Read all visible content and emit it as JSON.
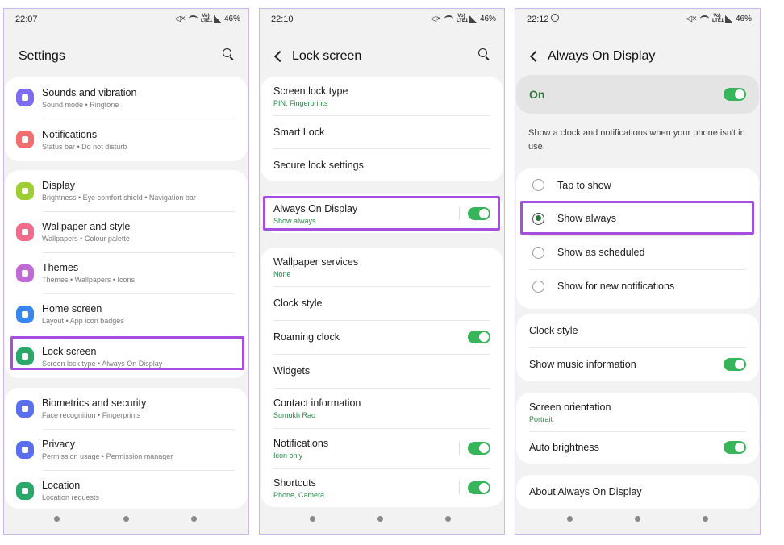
{
  "screens": [
    {
      "time": "22:07",
      "battery": "46%",
      "title": "Settings",
      "groups": [
        [
          {
            "icon": "sound-icon",
            "color": "#7b6cf0",
            "title": "Sounds and vibration",
            "sub": "Sound mode  •  Ringtone"
          },
          {
            "icon": "notification-icon",
            "color": "#f26d6d",
            "title": "Notifications",
            "sub": "Status bar  •  Do not disturb"
          }
        ],
        [
          {
            "icon": "display-icon",
            "color": "#9ccf2f",
            "title": "Display",
            "sub": "Brightness  •  Eye comfort shield  •  Navigation bar"
          },
          {
            "icon": "wallpaper-icon",
            "color": "#f06a8a",
            "title": "Wallpaper and style",
            "sub": "Wallpapers  •  Colour palette"
          },
          {
            "icon": "themes-icon",
            "color": "#c06ad8",
            "title": "Themes",
            "sub": "Themes  •  Wallpapers  •  Icons"
          },
          {
            "icon": "home-icon",
            "color": "#3a86f0",
            "title": "Home screen",
            "sub": "Layout  •  App icon badges"
          },
          {
            "icon": "lock-icon",
            "color": "#2aa86a",
            "title": "Lock screen",
            "sub": "Screen lock type  •  Always On Display"
          }
        ],
        [
          {
            "icon": "shield-icon",
            "color": "#5a6ef0",
            "title": "Biometrics and security",
            "sub": "Face recognition  •  Fingerprints"
          },
          {
            "icon": "privacy-icon",
            "color": "#5a6ef0",
            "title": "Privacy",
            "sub": "Permission usage  •  Permission manager"
          },
          {
            "icon": "location-icon",
            "color": "#2aa86a",
            "title": "Location",
            "sub": "Location requests"
          }
        ]
      ]
    },
    {
      "time": "22:10",
      "battery": "46%",
      "title": "Lock screen",
      "groups": [
        [
          {
            "title": "Screen lock type",
            "sub": "PIN, Fingerprints"
          },
          {
            "title": "Smart Lock",
            "sub": ""
          },
          {
            "title": "Secure lock settings",
            "sub": ""
          }
        ],
        [
          {
            "title": "Always On Display",
            "sub": "Show always",
            "toggle": true
          }
        ],
        [
          {
            "title": "Wallpaper services",
            "sub": "None"
          },
          {
            "title": "Clock style",
            "sub": ""
          },
          {
            "title": "Roaming clock",
            "sub": "",
            "toggle": true
          },
          {
            "title": "Widgets",
            "sub": ""
          },
          {
            "title": "Contact information",
            "sub": "Sumukh Rao"
          },
          {
            "title": "Notifications",
            "sub": "Icon only",
            "toggle": true
          },
          {
            "title": "Shortcuts",
            "sub": "Phone, Camera",
            "toggle": true
          }
        ]
      ]
    },
    {
      "time": "22:12",
      "battery": "46%",
      "title": "Always On Display",
      "on_label": "On",
      "description": "Show a clock and notifications when your phone isn't in use.",
      "radio_options": [
        {
          "label": "Tap to show",
          "selected": false
        },
        {
          "label": "Show always",
          "selected": true
        },
        {
          "label": "Show as scheduled",
          "selected": false
        },
        {
          "label": "Show for new notifications",
          "selected": false
        }
      ],
      "groups": [
        [
          {
            "title": "Clock style",
            "sub": ""
          },
          {
            "title": "Show music information",
            "sub": "",
            "toggle": true
          }
        ],
        [
          {
            "title": "Screen orientation",
            "sub": "Portrait"
          },
          {
            "title": "Auto brightness",
            "sub": "",
            "toggle": true
          }
        ],
        [
          {
            "title": "About Always On Display",
            "sub": ""
          }
        ]
      ]
    }
  ],
  "status_text": {
    "lte": "Vo) LTE1"
  },
  "colors": {
    "accent_green": "#38b45b",
    "highlight_purple": "#a64ee0"
  }
}
